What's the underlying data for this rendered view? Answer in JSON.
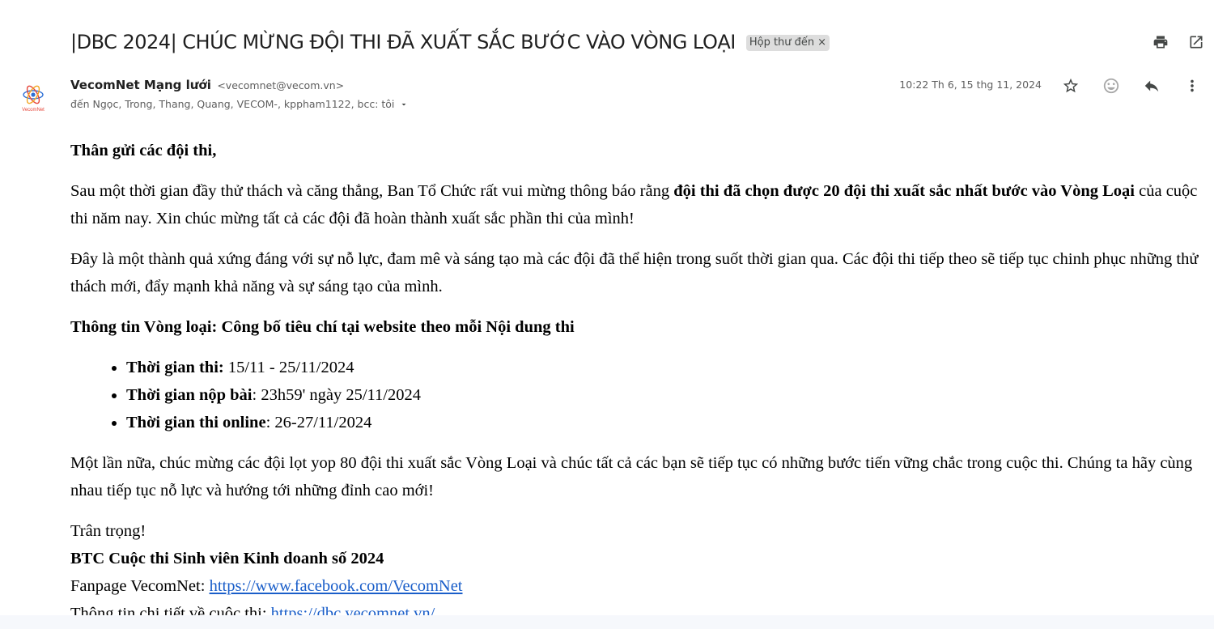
{
  "email": {
    "subject": "|DBC 2024| CHÚC MỪNG ĐỘI THI ĐÃ XUẤT SẮC BƯỚC VÀO VÒNG LOẠI",
    "label": "Hộp thư đến",
    "label_remove": "×",
    "sender_name": "VecomNet Mạng lưới",
    "sender_email": "<vecomnet@vecom.vn>",
    "recipients": "đến Ngọc, Trong, Thang, Quang, VECOM-, kppham1122, bcc: tôi",
    "timestamp": "10:22 Th 6, 15 thg 11, 2024",
    "avatar_text": "VecomNet"
  },
  "icons": {
    "print": "print-icon",
    "open_new_window": "open-in-new-icon",
    "star": "star-icon",
    "emoji": "emoji-icon",
    "reply": "reply-icon",
    "more": "more-vert-icon",
    "recipients_caret": "caret-down-icon"
  },
  "body": {
    "greeting": "Thân gửi các đội thi,",
    "p1_text": "Sau một thời gian đầy thử thách và căng thẳng, Ban Tổ Chức rất vui mừng thông báo rằng ",
    "p1_bold": "đội thi đã chọn được 20 đội thi xuất sắc nhất bước vào Vòng Loại",
    "p1_end": " của cuộc thi năm nay. Xin chúc mừng tất cả các đội đã hoàn thành xuất sắc phần thi của mình!",
    "p2": "Đây là một thành quả xứng đáng với sự nỗ lực, đam mê và sáng tạo mà các đội đã thể hiện trong suốt thời gian qua. Các đội thi tiếp theo sẽ tiếp tục chinh phục những thử thách mới, đẩy mạnh khả năng và sự sáng tạo của mình.",
    "info_heading": "Thông tin Vòng loại: Công bố tiêu chí tại website theo mỗi Nội dung thi",
    "schedule": [
      {
        "label": "Thời gian thi:",
        "value": " 15/11 - 25/11/2024"
      },
      {
        "label": "Thời gian nộp bài",
        "value": ": 23h59' ngày 25/11/2024"
      },
      {
        "label": "Thời gian thi online",
        "value": ": 26-27/11/2024"
      }
    ],
    "p3": "Một lần nữa, chúc mừng các đội lọt yop 80 đội thi xuất sắc Vòng Loại và chúc tất cả các bạn sẽ tiếp tục có những bước tiến vững chắc trong cuộc thi. Chúng ta hãy cùng nhau tiếp tục nỗ lực và hướng tới những đỉnh cao mới!",
    "closing": "Trân trọng!",
    "signature_org": "BTC Cuộc thi Sinh viên Kinh doanh số 2024",
    "fanpage_label": "Fanpage VecomNet: ",
    "fanpage_url": "https://www.facebook.com/VecomNet",
    "details_label": "Thông tin chi tiết về cuộc thi: ",
    "details_url": "https://dbc.vecomnet.vn/"
  }
}
